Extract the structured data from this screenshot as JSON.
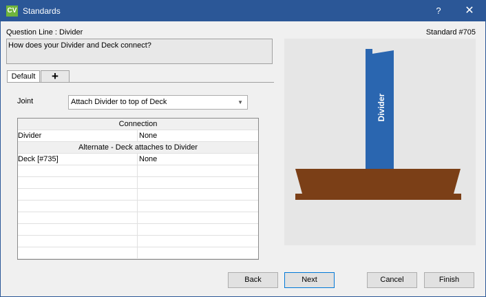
{
  "window": {
    "title": "Standards",
    "app_icon_text": "CV",
    "help_glyph": "?",
    "close_glyph": "✕"
  },
  "question": {
    "label": "Question Line : Divider",
    "standard": "Standard #705",
    "text": "How does your Divider and Deck connect?"
  },
  "tabs": [
    {
      "label": "Default"
    },
    {
      "label": "+"
    }
  ],
  "joint": {
    "label": "Joint",
    "value": "Attach Divider to top of Deck"
  },
  "grid": {
    "sections": [
      {
        "header": "Connection",
        "rows": [
          {
            "name": "Divider",
            "value": "None"
          }
        ]
      },
      {
        "header": "Alternate - Deck attaches to Divider",
        "rows": [
          {
            "name": "Deck [#735]",
            "value": "None"
          }
        ]
      }
    ]
  },
  "preview": {
    "divider_label": "Divider",
    "colors": {
      "divider": "#2a66b0",
      "deck": "#7b3f17",
      "background": "#e6e6e6"
    }
  },
  "buttons": {
    "back": "Back",
    "next": "Next",
    "cancel": "Cancel",
    "finish": "Finish"
  }
}
